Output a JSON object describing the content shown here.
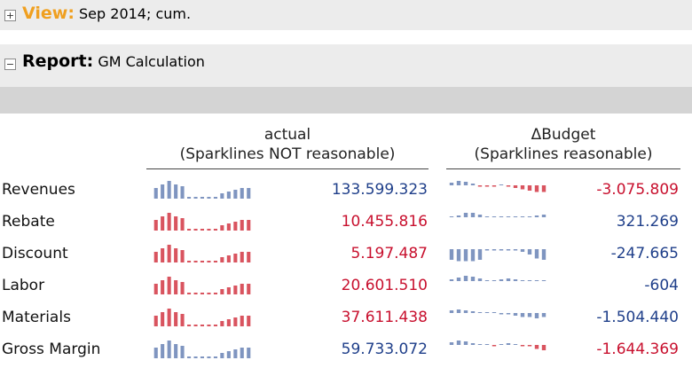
{
  "view": {
    "toggle": "+",
    "key": "View:",
    "value": "Sep 2014; cum."
  },
  "report": {
    "toggle": "−",
    "key": "Report:",
    "value": "GM Calculation"
  },
  "columns": {
    "actual": {
      "title": "actual",
      "subtitle": "(Sparklines NOT reasonable)"
    },
    "budget": {
      "title": "ΔBudget",
      "subtitle": "(Sparklines reasonable)"
    }
  },
  "colors": {
    "blue": "#7f95c0",
    "red": "#d9545f",
    "value_blue": "#1f3f8a",
    "value_red": "#c8102e"
  },
  "rows": [
    {
      "label": "Revenues",
      "actual": "133.599.323",
      "actual_color": "blue",
      "budget": "-3.075.809",
      "budget_color": "red",
      "spark_actual": [
        6,
        8,
        10,
        8,
        7,
        1,
        1,
        1,
        1,
        1,
        3,
        4,
        5,
        6,
        6
      ],
      "spark_budget": [
        3,
        5,
        4,
        2,
        -1,
        -1,
        -1,
        0,
        -1,
        -2,
        -3,
        -4,
        -5,
        -5
      ]
    },
    {
      "label": "Rebate",
      "actual": "10.455.816",
      "actual_color": "red",
      "budget": "321.269",
      "budget_color": "blue",
      "spark_actual": [
        6,
        8,
        10,
        8,
        7,
        1,
        1,
        1,
        1,
        1,
        3,
        4,
        5,
        6,
        6
      ],
      "spark_budget": [
        1,
        2,
        5,
        5,
        3,
        1,
        1,
        1,
        1,
        1,
        1,
        1,
        2,
        3
      ]
    },
    {
      "label": "Discount",
      "actual": "5.197.487",
      "actual_color": "red",
      "budget": "-247.665",
      "budget_color": "blue",
      "spark_actual": [
        6,
        8,
        10,
        8,
        7,
        1,
        1,
        1,
        1,
        1,
        3,
        4,
        5,
        6,
        6
      ],
      "spark_budget": [
        -8,
        -9,
        -9,
        -9,
        -8,
        -1,
        -1,
        -1,
        -1,
        -1,
        -2,
        -4,
        -7,
        -8
      ]
    },
    {
      "label": "Labor",
      "actual": "20.601.510",
      "actual_color": "red",
      "budget": "-604",
      "budget_color": "blue",
      "spark_actual": [
        6,
        8,
        10,
        8,
        7,
        1,
        1,
        1,
        1,
        1,
        3,
        4,
        5,
        6,
        6
      ],
      "spark_budget": [
        2,
        4,
        6,
        5,
        3,
        1,
        1,
        2,
        3,
        2,
        1,
        1,
        1,
        1
      ]
    },
    {
      "label": "Materials",
      "actual": "37.611.438",
      "actual_color": "red",
      "budget": "-1.504.440",
      "budget_color": "blue",
      "spark_actual": [
        6,
        8,
        10,
        8,
        7,
        1,
        1,
        1,
        1,
        1,
        3,
        4,
        5,
        6,
        6
      ],
      "spark_budget": [
        3,
        4,
        3,
        2,
        1,
        0,
        0,
        -1,
        -1,
        -2,
        -3,
        -3,
        -4,
        -3
      ]
    },
    {
      "label": "Gross Margin",
      "actual": "59.733.072",
      "actual_color": "blue",
      "budget": "-1.644.369",
      "budget_color": "red",
      "spark_actual": [
        6,
        8,
        10,
        8,
        7,
        1,
        1,
        1,
        1,
        1,
        3,
        4,
        5,
        6,
        6
      ],
      "spark_budget": [
        3,
        5,
        4,
        2,
        1,
        1,
        -1,
        1,
        2,
        1,
        -1,
        -1,
        -3,
        -4
      ]
    }
  ]
}
